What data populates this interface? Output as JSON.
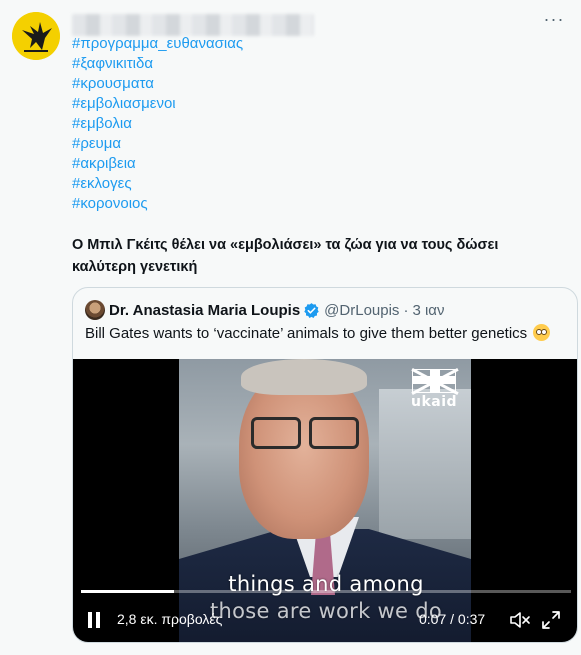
{
  "tweet": {
    "hashtags": [
      "#προγραμμα_ευθανασιας",
      "#ξαφνικιτιδα",
      "#κρουσματα",
      "#εμβολιασμενοι",
      "#εμβολια",
      "#ρευμα",
      "#ακριβεια",
      "#εκλογες",
      "#κορονοιος"
    ],
    "text_line1": "Ο Μπιλ Γκέιτς θέλει να «εμβολιάσει» τα ζώα για να τους δώσει",
    "text_line2": "καλύτερη γενετική",
    "more_label": "···"
  },
  "quote": {
    "author_name": "Dr. Anastasia Maria Loupis",
    "handle": "@DrLoupis",
    "separator": "·",
    "time": "3 ιαν",
    "text": "Bill Gates wants to ‘vaccinate’ animals to give them better genetics"
  },
  "video": {
    "watermark": "ukaid",
    "caption_line1": "things and among",
    "caption_line2": "those are work we do",
    "views": "2,8 εκ. προβολές",
    "time": "0:07 / 0:37",
    "progress": 0.19
  },
  "colors": {
    "link": "#1d9bf0",
    "text": "#0f1419",
    "secondary": "#536471",
    "verified": "#1d9bf0"
  }
}
